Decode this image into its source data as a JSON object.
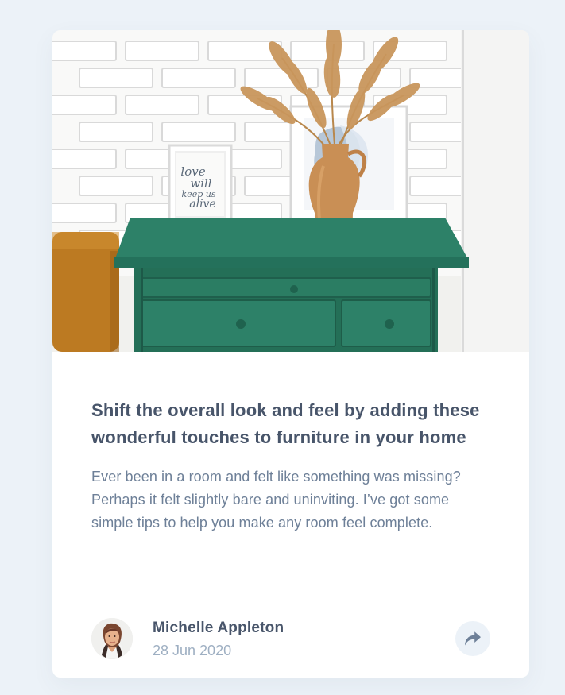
{
  "article": {
    "title": "Shift the overall look and feel by adding these wonderful touches to furniture in your home",
    "description": "Ever been in a room and felt like something was missing? Perhaps it felt slightly bare and uninviting. I’ve got some simple tips to help you make any room feel complete."
  },
  "author": {
    "name": "Michelle Appleton",
    "date": "28 Jun 2020"
  },
  "hero_image": {
    "frame_text_line_1": "love",
    "frame_text_line_2": "will",
    "frame_text_line_3": "keep us",
    "frame_text_line_4": "alive"
  },
  "icons": {
    "share": "share-icon"
  },
  "colors": {
    "page_background": "#ECF2F8",
    "card_background": "#FFFFFF",
    "heading": "#48556A",
    "body": "#6E8098",
    "muted": "#9EAFC2",
    "icon": "#6E8098"
  }
}
